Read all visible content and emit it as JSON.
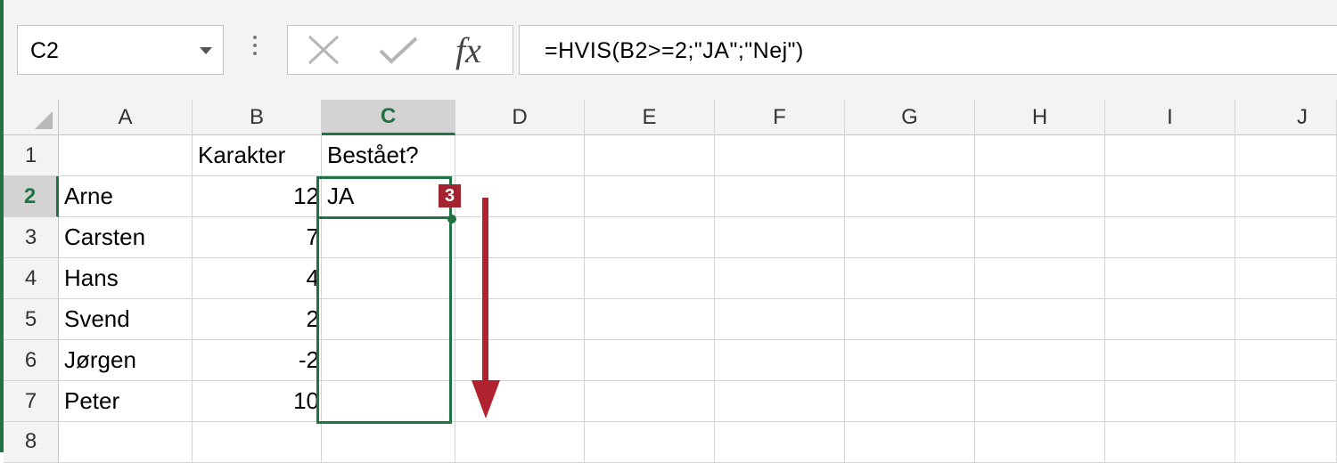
{
  "name_box": {
    "value": "C2"
  },
  "formula_bar": {
    "value": "=HVIS(B2>=2;\"JA\";\"Nej\")",
    "fx_label": "fx"
  },
  "columns": [
    "A",
    "B",
    "C",
    "D",
    "E",
    "F",
    "G",
    "H",
    "I",
    "J"
  ],
  "rows": [
    "1",
    "2",
    "3",
    "4",
    "5",
    "6",
    "7",
    "8"
  ],
  "cells": {
    "B1": "Karakter",
    "C1": "Bestået?",
    "A2": "Arne",
    "B2": "12",
    "C2": "JA",
    "A3": "Carsten",
    "B3": "7",
    "A4": "Hans",
    "B4": "4",
    "A5": "Svend",
    "B5": "2",
    "A6": "Jørgen",
    "B6": "-2",
    "A7": "Peter",
    "B7": "10"
  },
  "selection": {
    "active_cell": "C2",
    "range": "C2:C7"
  },
  "step_badge": "3",
  "colors": {
    "accent_green": "#217346",
    "badge_red": "#a32331",
    "arrow_red": "#b0222d"
  },
  "icons": {
    "cancel": "cancel-x-icon",
    "enter": "checkmark-icon",
    "name_dropdown": "chevron-down-icon"
  }
}
